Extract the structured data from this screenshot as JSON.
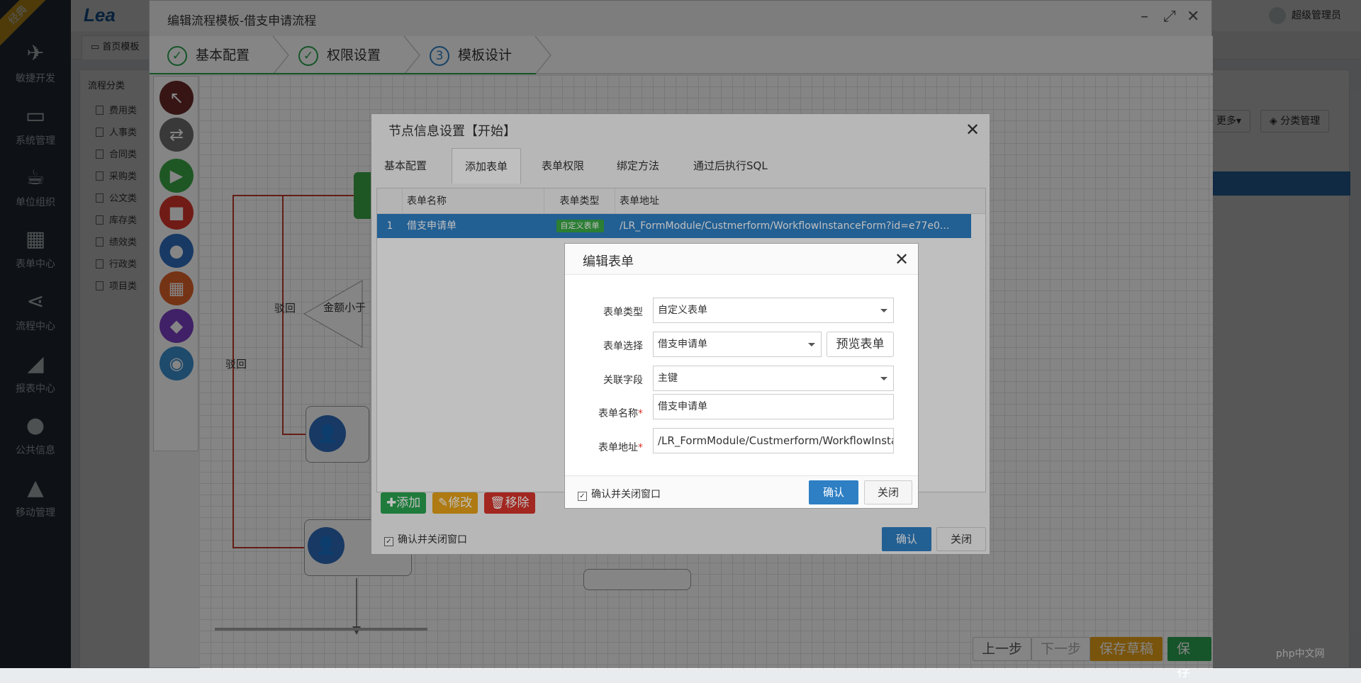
{
  "nav": {
    "badge": "经典",
    "items": [
      {
        "label": "敏捷开发",
        "icon": "paper-plane-icon"
      },
      {
        "label": "系统管理",
        "icon": "monitor-icon"
      },
      {
        "label": "单位组织",
        "icon": "coffee-cup-icon"
      },
      {
        "label": "表单中心",
        "icon": "table-grid-icon"
      },
      {
        "label": "流程中心",
        "icon": "share-nodes-icon"
      },
      {
        "label": "报表中心",
        "icon": "area-chart-icon"
      },
      {
        "label": "公共信息",
        "icon": "globe-icon"
      },
      {
        "label": "移动管理",
        "icon": "android-icon"
      }
    ]
  },
  "topbar": {
    "logo": "Lea",
    "user": "超级管理员"
  },
  "bg": {
    "home_tab": "首页模板",
    "category_title": "流程分类",
    "categories": [
      "费用类",
      "人事类",
      "合同类",
      "采购类",
      "公文类",
      "库存类",
      "绩效类",
      "行政类",
      "项目类"
    ],
    "more_button": "更多▾",
    "category_manage_button": "分类管理"
  },
  "window": {
    "title": "编辑流程模板-借支申请流程",
    "steps": [
      {
        "label": "基本配置",
        "mark": "✓"
      },
      {
        "label": "权限设置",
        "mark": "✓"
      },
      {
        "label": "模板设计",
        "mark": "3"
      }
    ],
    "flow_labels": {
      "reject1": "驳回",
      "reject2": "驳回",
      "condition": "金额小于"
    },
    "bottom_buttons": {
      "prev": "上一步",
      "next": "下一步",
      "save_draft": "保存草稿",
      "save": "保存"
    }
  },
  "node_dialog": {
    "title": "节点信息设置【开始】",
    "tabs": [
      "基本配置",
      "添加表单",
      "表单权限",
      "绑定方法",
      "通过后执行SQL"
    ],
    "active_tab": "添加表单",
    "columns": [
      "表单名称",
      "表单类型",
      "表单地址"
    ],
    "rows": [
      {
        "index": "1",
        "name": "借支申请单",
        "type": "自定义表单",
        "url": "/LR_FormModule/Custmerform/WorkflowInstanceForm?id=e77e0..."
      }
    ],
    "buttons": {
      "add": "添加",
      "edit": "修改",
      "remove": "移除"
    },
    "confirm_close_label": "确认并关闭窗口",
    "ok": "确认",
    "close": "关闭"
  },
  "form_dialog": {
    "title": "编辑表单",
    "fields": {
      "form_type": {
        "label": "表单类型",
        "value": "自定义表单"
      },
      "form_select": {
        "label": "表单选择",
        "value": "借支申请单",
        "preview": "预览表单"
      },
      "relation_field": {
        "label": "关联字段",
        "value": "主键"
      },
      "form_name": {
        "label": "表单名称",
        "value": "借支申请单"
      },
      "form_url": {
        "label": "表单地址",
        "value": "/LR_FormModule/Custmerform/WorkflowInsta"
      }
    },
    "required_mark": "*",
    "confirm_close_label": "确认并关闭窗口",
    "ok": "确认",
    "close": "关闭"
  },
  "watermark": "php中文网"
}
